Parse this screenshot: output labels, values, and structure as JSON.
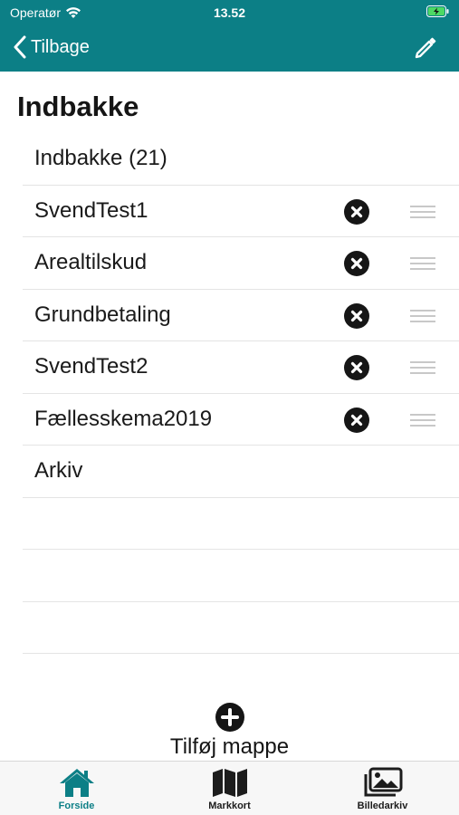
{
  "status_bar": {
    "carrier": "Operatør",
    "time": "13.52"
  },
  "nav": {
    "back_label": "Tilbage",
    "edit_icon": "pencil-icon"
  },
  "page": {
    "title": "Indbakke"
  },
  "folders": [
    {
      "label": "Indbakke (21)",
      "editable": false
    },
    {
      "label": "SvendTest1",
      "editable": true
    },
    {
      "label": "Arealtilskud",
      "editable": true
    },
    {
      "label": "Grundbetaling",
      "editable": true
    },
    {
      "label": "SvendTest2",
      "editable": true
    },
    {
      "label": "Fællesskema2019",
      "editable": true
    },
    {
      "label": "Arkiv",
      "editable": false
    },
    {
      "label": "",
      "editable": false
    },
    {
      "label": "",
      "editable": false
    },
    {
      "label": "",
      "editable": false
    }
  ],
  "add_folder": {
    "label": "Tilføj mappe",
    "icon": "plus-circle-icon"
  },
  "tabs": [
    {
      "label": "Forside",
      "icon": "home-icon",
      "active": true
    },
    {
      "label": "Markkort",
      "icon": "map-icon",
      "active": false
    },
    {
      "label": "Billedarkiv",
      "icon": "photo-gallery-icon",
      "active": false
    }
  ],
  "colors": {
    "brand": "#0c7f86",
    "active_tab": "#0c7f86",
    "inactive_tab": "#1c1c1c"
  }
}
